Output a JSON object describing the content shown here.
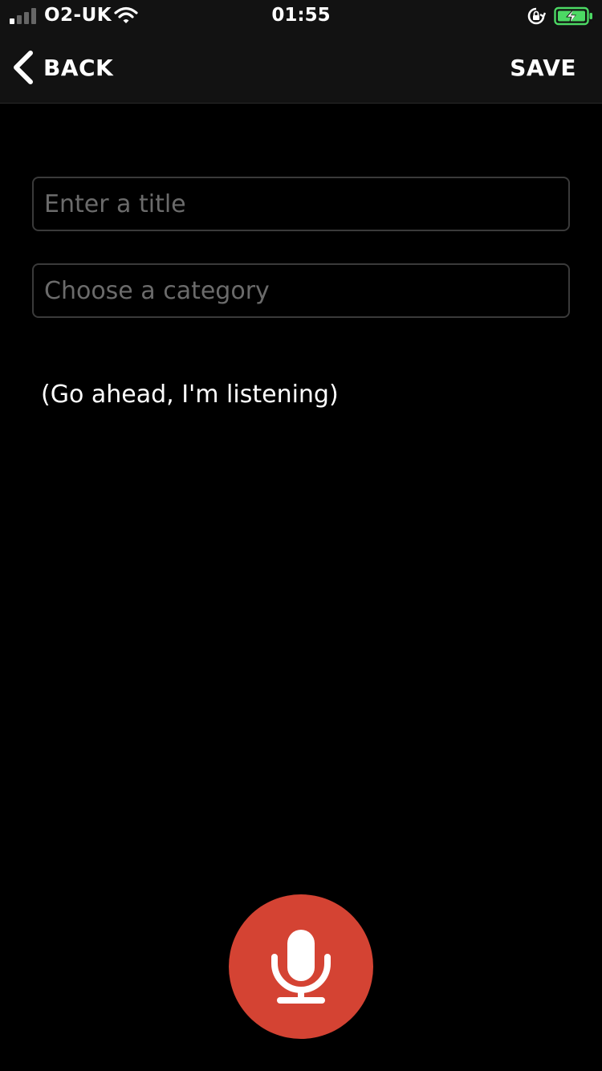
{
  "status_bar": {
    "carrier": "O2-UK",
    "time": "01:55",
    "signal_bars_active": 1,
    "signal_bars_total": 4,
    "battery_color": "#4cd964",
    "icons": [
      "signal-bars-icon",
      "wifi-icon",
      "rotation-lock-icon",
      "battery-charging-icon"
    ]
  },
  "nav": {
    "back_label": "BACK",
    "save_label": "SAVE",
    "back_icon": "chevron-left-icon"
  },
  "form": {
    "title_placeholder": "Enter a title",
    "title_value": "",
    "category_placeholder": "Choose a category",
    "category_value": ""
  },
  "status_text": "(Go ahead, I'm listening)",
  "mic": {
    "icon": "microphone-icon",
    "color": "#d44333"
  }
}
